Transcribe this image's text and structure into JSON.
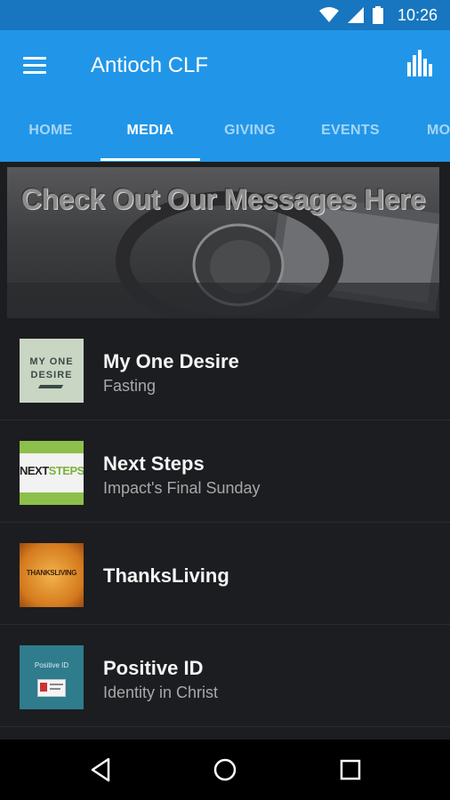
{
  "status_bar": {
    "time": "10:26"
  },
  "app_bar": {
    "title": "Antioch CLF"
  },
  "tabs": [
    {
      "label": "HOME"
    },
    {
      "label": "MEDIA"
    },
    {
      "label": "GIVING"
    },
    {
      "label": "EVENTS"
    },
    {
      "label": "MO"
    }
  ],
  "banner": {
    "text": "Check Out Our Messages Here"
  },
  "media_items": [
    {
      "title": "My One Desire",
      "subtitle": "Fasting",
      "thumb_text": [
        "MY ONE",
        "DESIRE"
      ]
    },
    {
      "title": "Next Steps",
      "subtitle": "Impact's Final Sunday",
      "thumb_text": [
        "NEXT",
        "STEPS"
      ]
    },
    {
      "title": "ThanksLiving",
      "subtitle": "",
      "thumb_text": [
        "THANKSLIVING"
      ]
    },
    {
      "title": "Positive ID",
      "subtitle": "Identity in Christ",
      "thumb_text": [
        "Positive ID"
      ]
    }
  ],
  "colors": {
    "primary": "#2196e8",
    "status": "#1776bf",
    "background": "#1c1d20"
  }
}
